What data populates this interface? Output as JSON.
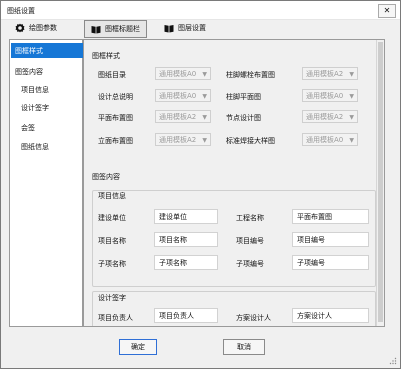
{
  "window": {
    "title": "图纸设置",
    "close_glyph": "✕"
  },
  "toolbar": {
    "tabs": [
      {
        "label": "绘图参数",
        "icon": "gear-icon"
      },
      {
        "label": "图框标题栏",
        "icon": "book-icon"
      },
      {
        "label": "图层设置",
        "icon": "book-icon"
      }
    ]
  },
  "nav": {
    "items": [
      {
        "label": "图框样式"
      },
      {
        "label": "图签内容"
      },
      {
        "label": "项目信息"
      },
      {
        "label": "设计签字"
      },
      {
        "label": "会签"
      },
      {
        "label": "图纸信息"
      }
    ]
  },
  "frame_style": {
    "title": "图框样式",
    "rows": [
      [
        {
          "label": "图纸目录",
          "value": "通用模板A0"
        },
        {
          "label": "柱脚螺栓布置图",
          "value": "通用模板A2"
        }
      ],
      [
        {
          "label": "设计总说明",
          "value": "通用模板A0"
        },
        {
          "label": "柱脚平面图",
          "value": "通用模板A0"
        }
      ],
      [
        {
          "label": "平面布置图",
          "value": "通用模板A2"
        },
        {
          "label": "节点设计图",
          "value": "通用模板A2"
        }
      ],
      [
        {
          "label": "立面布置图",
          "value": "通用模板A2"
        },
        {
          "label": "标准焊接大样图",
          "value": "通用模板A0"
        }
      ]
    ]
  },
  "title_block": {
    "title": "图签内容",
    "project_info": {
      "title": "项目信息",
      "rows": [
        [
          {
            "label": "建设单位",
            "value": "建设单位"
          },
          {
            "label": "工程名称",
            "value": "平面布置图"
          }
        ],
        [
          {
            "label": "项目名称",
            "value": "项目名称"
          },
          {
            "label": "项目编号",
            "value": "项目编号"
          }
        ],
        [
          {
            "label": "子项名称",
            "value": "子项名称"
          },
          {
            "label": "子项编号",
            "value": "子项编号"
          }
        ]
      ]
    },
    "design_sign": {
      "title": "设计签字",
      "rows": [
        [
          {
            "label": "项目负责人",
            "value": "项目负责人"
          },
          {
            "label": "方案设计人",
            "value": "方案设计人"
          }
        ]
      ]
    }
  },
  "footer": {
    "ok_label": "确定",
    "cancel_label": "取消"
  },
  "colors": {
    "selection": "#1677d6",
    "window_bg": "#f0f0f0"
  }
}
